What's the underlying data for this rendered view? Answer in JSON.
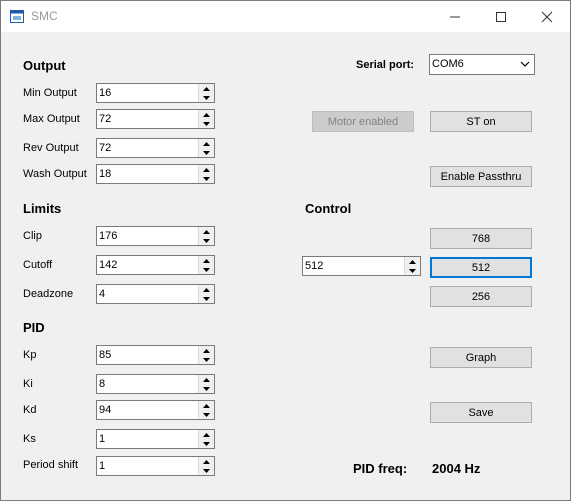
{
  "window": {
    "title": "SMC"
  },
  "output": {
    "heading": "Output",
    "fields": [
      {
        "label": "Min Output",
        "value": "16"
      },
      {
        "label": "Max Output",
        "value": "72"
      },
      {
        "label": "Rev Output",
        "value": "72"
      },
      {
        "label": "Wash Output",
        "value": "18"
      }
    ]
  },
  "limits": {
    "heading": "Limits",
    "fields": [
      {
        "label": "Clip",
        "value": "176"
      },
      {
        "label": "Cutoff",
        "value": "142"
      },
      {
        "label": "Deadzone",
        "value": "4"
      }
    ]
  },
  "pid": {
    "heading": "PID",
    "fields": [
      {
        "label": "Kp",
        "value": "85"
      },
      {
        "label": "Ki",
        "value": "8"
      },
      {
        "label": "Kd",
        "value": "94"
      },
      {
        "label": "Ks",
        "value": "1"
      },
      {
        "label": "Period shift",
        "value": "1"
      }
    ]
  },
  "serial": {
    "label": "Serial port:",
    "selected": "COM6"
  },
  "buttons": {
    "motor_enabled": "Motor enabled",
    "st_on": "ST on",
    "enable_passthru": "Enable Passthru",
    "graph": "Graph",
    "save": "Save"
  },
  "control": {
    "heading": "Control",
    "value": "512",
    "presets": [
      "768",
      "512",
      "256"
    ]
  },
  "pid_freq": {
    "label": "PID freq:",
    "value": "2004 Hz"
  }
}
